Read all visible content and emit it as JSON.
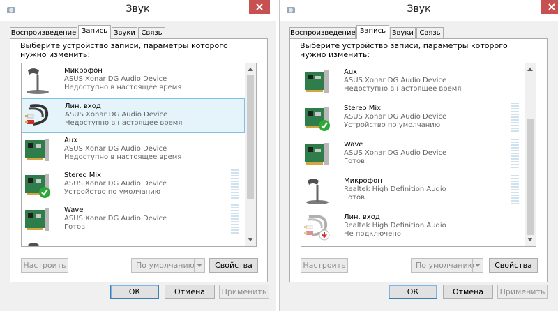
{
  "windows": [
    {
      "title": "Звук",
      "tabs": [
        "Воспроизведение",
        "Запись",
        "Звуки",
        "Связь"
      ],
      "active_tab": "Запись",
      "instruction": "Выберите устройство записи, параметры которого нужно изменить:",
      "devices": [
        {
          "name": "Микрофон",
          "driver": "ASUS Xonar DG Audio Device",
          "status": "Недоступно в настоящее время",
          "icon": "microphone-icon",
          "badge": "none",
          "selected": false
        },
        {
          "name": "Лин. вход",
          "driver": "ASUS Xonar DG Audio Device",
          "status": "Недоступно в настоящее время",
          "icon": "line-in-cable-icon",
          "badge": "none",
          "selected": true
        },
        {
          "name": "Aux",
          "driver": "ASUS Xonar DG Audio Device",
          "status": "Недоступно в настоящее время",
          "icon": "sound-card-icon",
          "badge": "none",
          "selected": false
        },
        {
          "name": "Stereo Mix",
          "driver": "ASUS Xonar DG Audio Device",
          "status": "Устройство по умолчанию",
          "icon": "sound-card-icon",
          "badge": "default-check",
          "selected": false
        },
        {
          "name": "Wave",
          "driver": "ASUS Xonar DG Audio Device",
          "status": "Готов",
          "icon": "sound-card-icon",
          "badge": "none",
          "selected": false
        }
      ],
      "buttons": {
        "configure": "Настроить",
        "set_default": "По умолчанию",
        "properties": "Свойства",
        "ok": "ОК",
        "cancel": "Отмена",
        "apply": "Применить"
      }
    },
    {
      "title": "Звук",
      "tabs": [
        "Воспроизведение",
        "Запись",
        "Звуки",
        "Связь"
      ],
      "active_tab": "Запись",
      "instruction": "Выберите устройство записи, параметры которого нужно изменить:",
      "devices": [
        {
          "name": "Aux",
          "driver": "ASUS Xonar DG Audio Device",
          "status": "Недоступно в настоящее время",
          "icon": "sound-card-icon",
          "badge": "none",
          "selected": false
        },
        {
          "name": "Stereo Mix",
          "driver": "ASUS Xonar DG Audio Device",
          "status": "Устройство по умолчанию",
          "icon": "sound-card-icon",
          "badge": "default-check",
          "selected": false
        },
        {
          "name": "Wave",
          "driver": "ASUS Xonar DG Audio Device",
          "status": "Готов",
          "icon": "sound-card-icon",
          "badge": "none",
          "selected": false
        },
        {
          "name": "Микрофон",
          "driver": "Realtek High Definition Audio",
          "status": "Готов",
          "icon": "microphone-icon",
          "badge": "none",
          "selected": false
        },
        {
          "name": "Лин. вход",
          "driver": "Realtek High Definition Audio",
          "status": "Не подключено",
          "icon": "line-in-cable-icon",
          "badge": "unplugged",
          "selected": false
        }
      ],
      "buttons": {
        "configure": "Настроить",
        "set_default": "По умолчанию",
        "properties": "Свойства",
        "ok": "ОК",
        "cancel": "Отмена",
        "apply": "Применить"
      }
    }
  ],
  "colors": {
    "close_button": "#c75050",
    "selection": "#e5f3fb",
    "default_check": "#2ea836",
    "unplugged": "#d03030"
  }
}
